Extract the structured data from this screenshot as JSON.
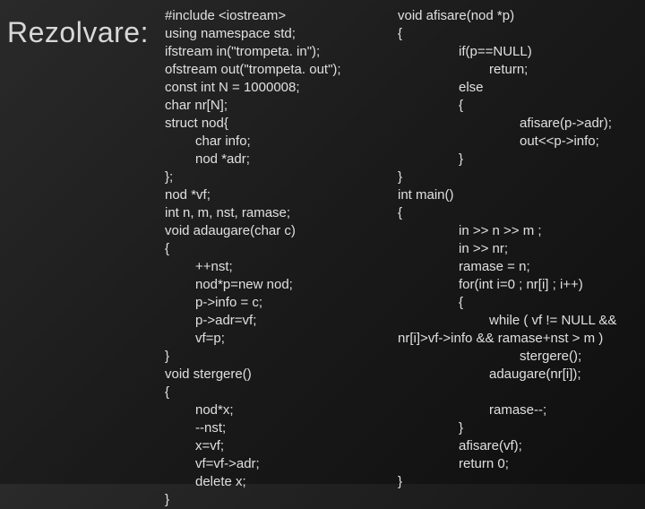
{
  "title": "Rezolvare:",
  "code_col1": [
    {
      "t": "#include <iostream>",
      "i": 0
    },
    {
      "t": "using namespace std;",
      "i": 0
    },
    {
      "t": "ifstream in(\"trompeta. in\");",
      "i": 0
    },
    {
      "t": "ofstream out(\"trompeta. out\");",
      "i": 0
    },
    {
      "t": "const int N = 1000008;",
      "i": 0
    },
    {
      "t": "char nr[N];",
      "i": 0
    },
    {
      "t": "struct nod{",
      "i": 0
    },
    {
      "t": "char info;",
      "i": 1
    },
    {
      "t": "nod *adr;",
      "i": 1
    },
    {
      "t": "};",
      "i": 0
    },
    {
      "t": "nod *vf;",
      "i": 0
    },
    {
      "t": "int n, m, nst, ramase;",
      "i": 0
    },
    {
      "t": "void adaugare(char c)",
      "i": 0
    },
    {
      "t": "{",
      "i": 0
    },
    {
      "t": "++nst;",
      "i": 1
    },
    {
      "t": "nod*p=new nod;",
      "i": 1
    },
    {
      "t": "p->info = c;",
      "i": 1
    },
    {
      "t": "p->adr=vf;",
      "i": 1
    },
    {
      "t": "vf=p;",
      "i": 1
    },
    {
      "t": "}",
      "i": 0
    },
    {
      "t": "void stergere()",
      "i": 0
    },
    {
      "t": "{",
      "i": 0
    },
    {
      "t": "nod*x;",
      "i": 1
    },
    {
      "t": "--nst;",
      "i": 1
    },
    {
      "t": "x=vf;",
      "i": 1
    },
    {
      "t": "vf=vf->adr;",
      "i": 1
    },
    {
      "t": "delete x;",
      "i": 1
    },
    {
      "t": "}",
      "i": 0
    }
  ],
  "code_col2": [
    {
      "t": "void afisare(nod *p)",
      "i": 0
    },
    {
      "t": "{",
      "i": 0
    },
    {
      "t": "if(p==NULL)",
      "i": 2
    },
    {
      "t": "return;",
      "i": 3
    },
    {
      "t": "else",
      "i": 2
    },
    {
      "t": "{",
      "i": 2
    },
    {
      "t": "afisare(p->adr);",
      "i": 4
    },
    {
      "t": "out<<p->info;",
      "i": 4
    },
    {
      "t": "}",
      "i": 2
    },
    {
      "t": "}",
      "i": 0
    },
    {
      "t": "int main()",
      "i": 0
    },
    {
      "t": "{",
      "i": 0
    },
    {
      "t": "in >> n >> m ;",
      "i": 2
    },
    {
      "t": "in >> nr;",
      "i": 2
    },
    {
      "t": "ramase = n;",
      "i": 2
    },
    {
      "t": "for(int i=0 ; nr[i] ; i++)",
      "i": 2
    },
    {
      "t": "{",
      "i": 2
    },
    {
      "t": "while ( vf != NULL &&",
      "i": 3
    },
    {
      "t": "nr[i]>vf->info && ramase+nst > m )",
      "i": 0
    },
    {
      "t": "stergere();",
      "i": 4
    },
    {
      "t": "adaugare(nr[i]);",
      "i": 3
    },
    {
      "t": "",
      "i": 0
    },
    {
      "t": "ramase--;",
      "i": 3
    },
    {
      "t": "}",
      "i": 2
    },
    {
      "t": "afisare(vf);",
      "i": 2
    },
    {
      "t": "return 0;",
      "i": 2
    },
    {
      "t": "}",
      "i": 0
    }
  ]
}
